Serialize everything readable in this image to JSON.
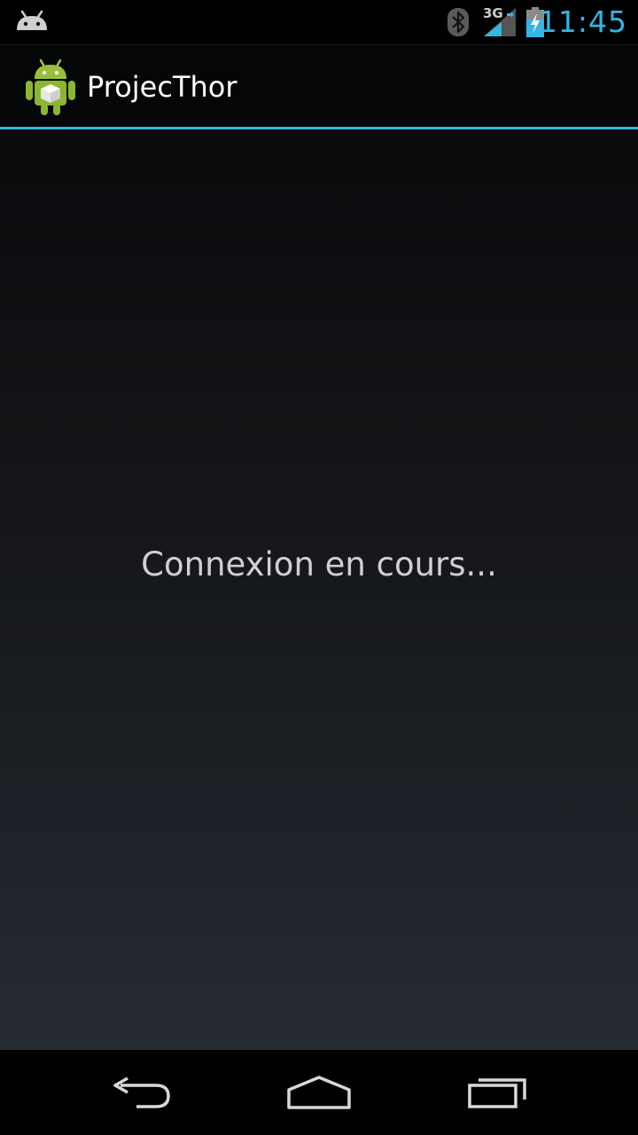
{
  "status_bar": {
    "notification_icon": "android-notification-icon",
    "bluetooth_icon": "bluetooth-icon",
    "network_label": "3G",
    "signal_icon": "signal-icon",
    "battery_icon": "battery-charging-icon",
    "time": "11:45"
  },
  "action_bar": {
    "app_icon": "android-app-icon",
    "title": "ProjecThor"
  },
  "content": {
    "message": "Connexion en cours..."
  },
  "nav_bar": {
    "back_icon": "back-icon",
    "home_icon": "home-icon",
    "recent_icon": "recent-apps-icon"
  },
  "colors": {
    "accent": "#33b5e5",
    "action_bar_bg": "#050607",
    "content_top": "#0a0b0d",
    "content_bottom": "#262a32",
    "message_text": "#cfd0d2"
  }
}
